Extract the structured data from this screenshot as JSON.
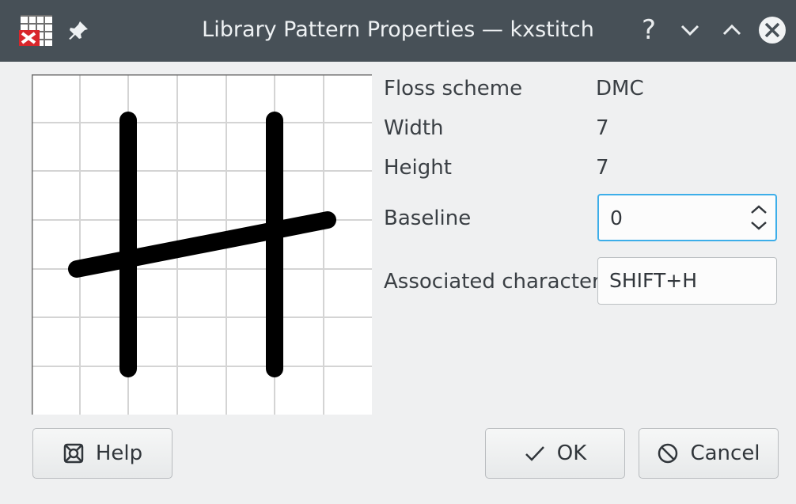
{
  "window": {
    "title": "Library Pattern Properties — kxstitch",
    "help_glyph": "?",
    "icons": [
      "kxstitch-app-icon",
      "pin-icon",
      "help-icon",
      "minimize-icon",
      "maximize-icon",
      "close-icon"
    ]
  },
  "properties": {
    "floss_scheme_label": "Floss scheme",
    "floss_scheme_value": "DMC",
    "width_label": "Width",
    "width_value": "7",
    "height_label": "Height",
    "height_value": "7",
    "baseline_label": "Baseline",
    "baseline_value": "0",
    "associated_character_label": "Associated character",
    "associated_character_value": "SHIFT+H"
  },
  "buttons": {
    "help_label": "Help",
    "ok_label": "OK",
    "cancel_label": "Cancel"
  },
  "colors": {
    "titlebar": "#475057",
    "focus": "#3daee9",
    "stitch": "#000000"
  }
}
